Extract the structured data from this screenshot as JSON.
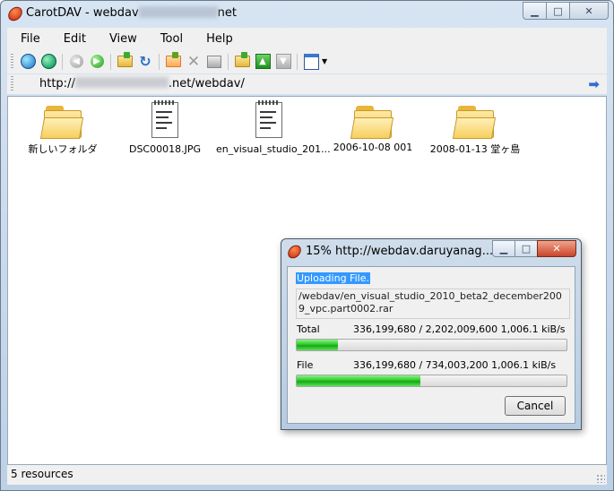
{
  "window": {
    "title_prefix": "CarotDAV - webdav",
    "title_suffix": "net",
    "icon": "carotdav-app-icon"
  },
  "menu": [
    "File",
    "Edit",
    "View",
    "Tool",
    "Help"
  ],
  "toolbar_icons": [
    "connect-icon",
    "disconnect-icon",
    "back-icon",
    "forward-icon",
    "parent-folder-icon",
    "refresh-icon",
    "new-folder-icon",
    "delete-icon",
    "properties-icon",
    "upload-folder-icon",
    "upload-icon",
    "download-icon",
    "view-mode-icon"
  ],
  "address": {
    "prefix": "http://",
    "suffix": ".net/webdav/"
  },
  "files": [
    {
      "name": "新しいフォルダ",
      "type": "folder"
    },
    {
      "name": "DSC00018.JPG",
      "type": "file"
    },
    {
      "name": "en_visual_studio_201...",
      "type": "file"
    },
    {
      "name": "2006-10-08 001",
      "type": "folder"
    },
    {
      "name": "2008-01-13 堂ヶ島",
      "type": "folder"
    }
  ],
  "status": {
    "text": "5 resources"
  },
  "dialog": {
    "title": "15% http://webdav.daruyanag...",
    "heading": "Uploading File.",
    "path": "/webdav/en_visual_studio_2010_beta2_december2009_vpc.part0002.rar",
    "total_label": "Total",
    "total_value": "336,199,680 / 2,202,009,600  1,006.1 kiB/s",
    "total_progress": 0.153,
    "file_label": "File",
    "file_value": "336,199,680 / 734,003,200  1,006.1 kiB/s",
    "file_progress": 0.458,
    "cancel_label": "Cancel"
  }
}
